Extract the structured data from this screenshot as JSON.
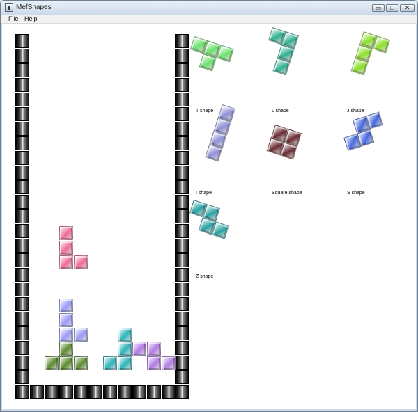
{
  "window": {
    "title": "MefShapes",
    "controls": {
      "minimize": "▭",
      "maximize": "□",
      "close": "✕"
    }
  },
  "menu": [
    "File",
    "Help"
  ],
  "well": {
    "columns": 12,
    "rows": 26
  },
  "shapes": [
    {
      "name": "T shape",
      "color": "#6be16b"
    },
    {
      "name": "L shape",
      "color": "#2fb090"
    },
    {
      "name": "J shape",
      "color": "#8be029"
    },
    {
      "name": "I shape",
      "color": "#8f8fd8"
    },
    {
      "name": "Square shape",
      "color": "#6b2a31"
    },
    {
      "name": "S shape",
      "color": "#4667e0"
    },
    {
      "name": "Z shape",
      "color": "#2aa2a4"
    }
  ],
  "active_piece": {
    "shape": "J shape",
    "color": "#f06a96"
  },
  "board_pieces": [
    {
      "shape": "L shape",
      "color": "#9b9af5"
    },
    {
      "shape": "T shape",
      "color": "#5a8a2d"
    },
    {
      "shape": "I shape",
      "color": "#2ab3b9"
    },
    {
      "shape": "Z shape",
      "color": "#b17be5"
    }
  ]
}
